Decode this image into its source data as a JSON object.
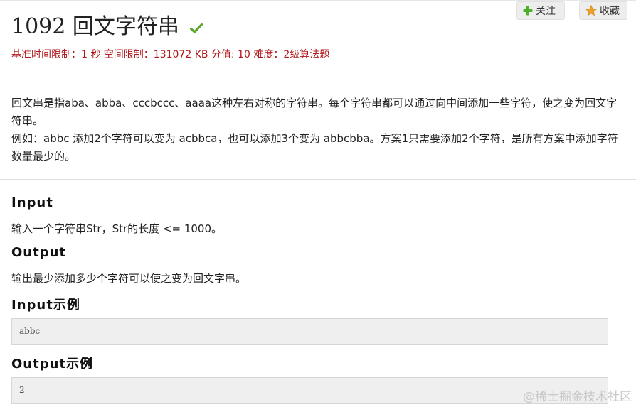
{
  "header": {
    "title": "1092 回文字符串",
    "follow_label": "关注",
    "favorite_label": "收藏",
    "meta": "基准时间限制：1 秒 空间限制：131072 KB 分值: 10 难度：2级算法题"
  },
  "description": {
    "para1": "回文串是指aba、abba、cccbccc、aaaa这种左右对称的字符串。每个字符串都可以通过向中间添加一些字符，使之变为回文字符串。",
    "para2": "例如：abbc 添加2个字符可以变为 acbbca，也可以添加3个变为 abbcbba。方案1只需要添加2个字符，是所有方案中添加字符数量最少的。"
  },
  "sections": {
    "input_heading": "Input",
    "input_text": "输入一个字符串Str，Str的长度 <= 1000。",
    "output_heading": "Output",
    "output_text": "输出最少添加多少个字符可以使之变为回文字串。",
    "input_example_heading": "Input示例",
    "input_example_value": "abbc",
    "output_example_heading": "Output示例",
    "output_example_value": "2"
  },
  "watermark": "@稀土掘金技术社区",
  "colors": {
    "meta_red": "#b0181c",
    "check_green": "#5aa52a",
    "plus_green": "#4caf2a",
    "star_orange": "#f0a020"
  },
  "icons": [
    "checkmark-icon",
    "plus-icon",
    "star-icon"
  ]
}
